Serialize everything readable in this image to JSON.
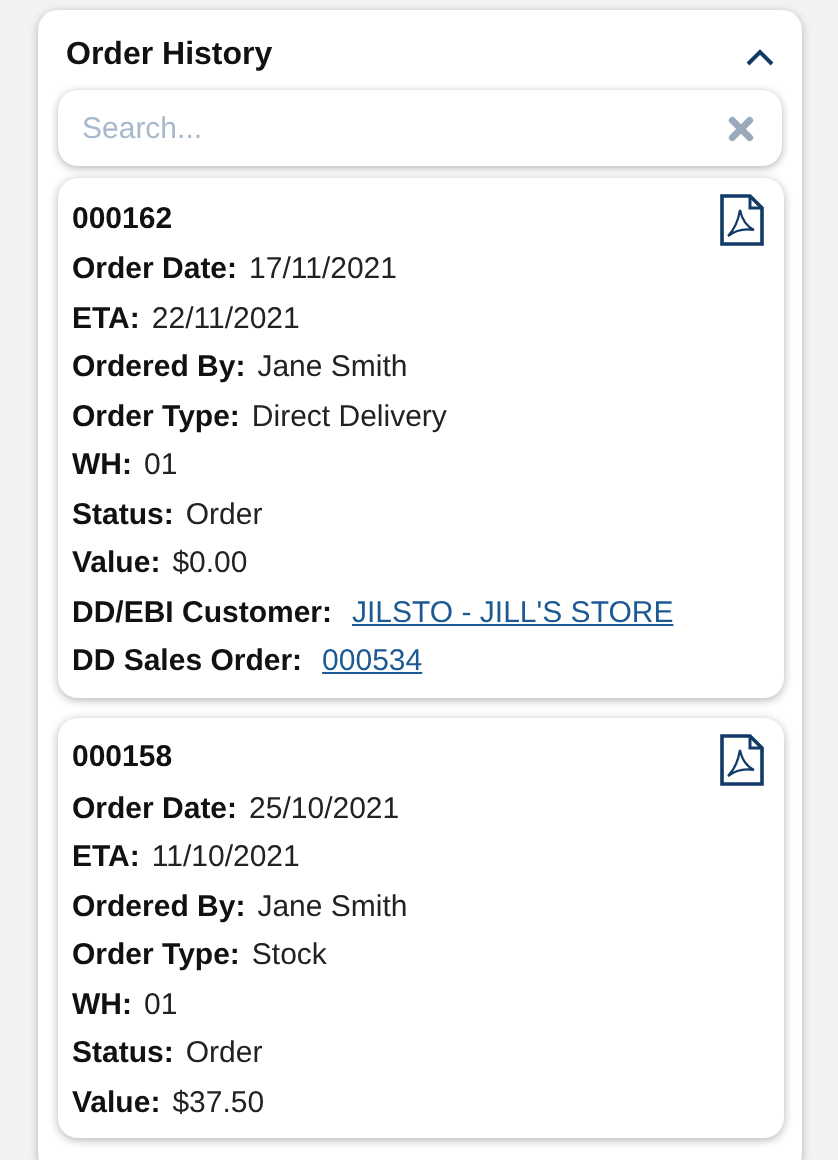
{
  "panel": {
    "title": "Order History",
    "expanded": true
  },
  "search": {
    "placeholder": "Search..."
  },
  "orders": [
    {
      "number": "000162",
      "fields": [
        {
          "label": "Order Date:",
          "value": "17/11/2021",
          "kind": "text"
        },
        {
          "label": "ETA:",
          "value": "22/11/2021",
          "kind": "text"
        },
        {
          "label": "Ordered By:",
          "value": "Jane Smith",
          "kind": "text"
        },
        {
          "label": "Order Type:",
          "value": "Direct Delivery",
          "kind": "text"
        },
        {
          "label": "WH:",
          "value": "01",
          "kind": "text"
        },
        {
          "label": "Status:",
          "value": "Order",
          "kind": "text"
        },
        {
          "label": "Value:",
          "value": "$0.00",
          "kind": "text"
        },
        {
          "label": "DD/EBI Customer:",
          "value": "JILSTO - JILL'S STORE",
          "kind": "link"
        },
        {
          "label": "DD Sales Order:",
          "value": "000534",
          "kind": "link"
        }
      ]
    },
    {
      "number": "000158",
      "fields": [
        {
          "label": "Order Date:",
          "value": "25/10/2021",
          "kind": "text"
        },
        {
          "label": "ETA:",
          "value": "11/10/2021",
          "kind": "text"
        },
        {
          "label": "Ordered By:",
          "value": "Jane Smith",
          "kind": "text"
        },
        {
          "label": "Order Type:",
          "value": "Stock",
          "kind": "text"
        },
        {
          "label": "WH:",
          "value": "01",
          "kind": "text"
        },
        {
          "label": "Status:",
          "value": "Order",
          "kind": "text"
        },
        {
          "label": "Value:",
          "value": "$37.50",
          "kind": "text"
        }
      ]
    }
  ]
}
